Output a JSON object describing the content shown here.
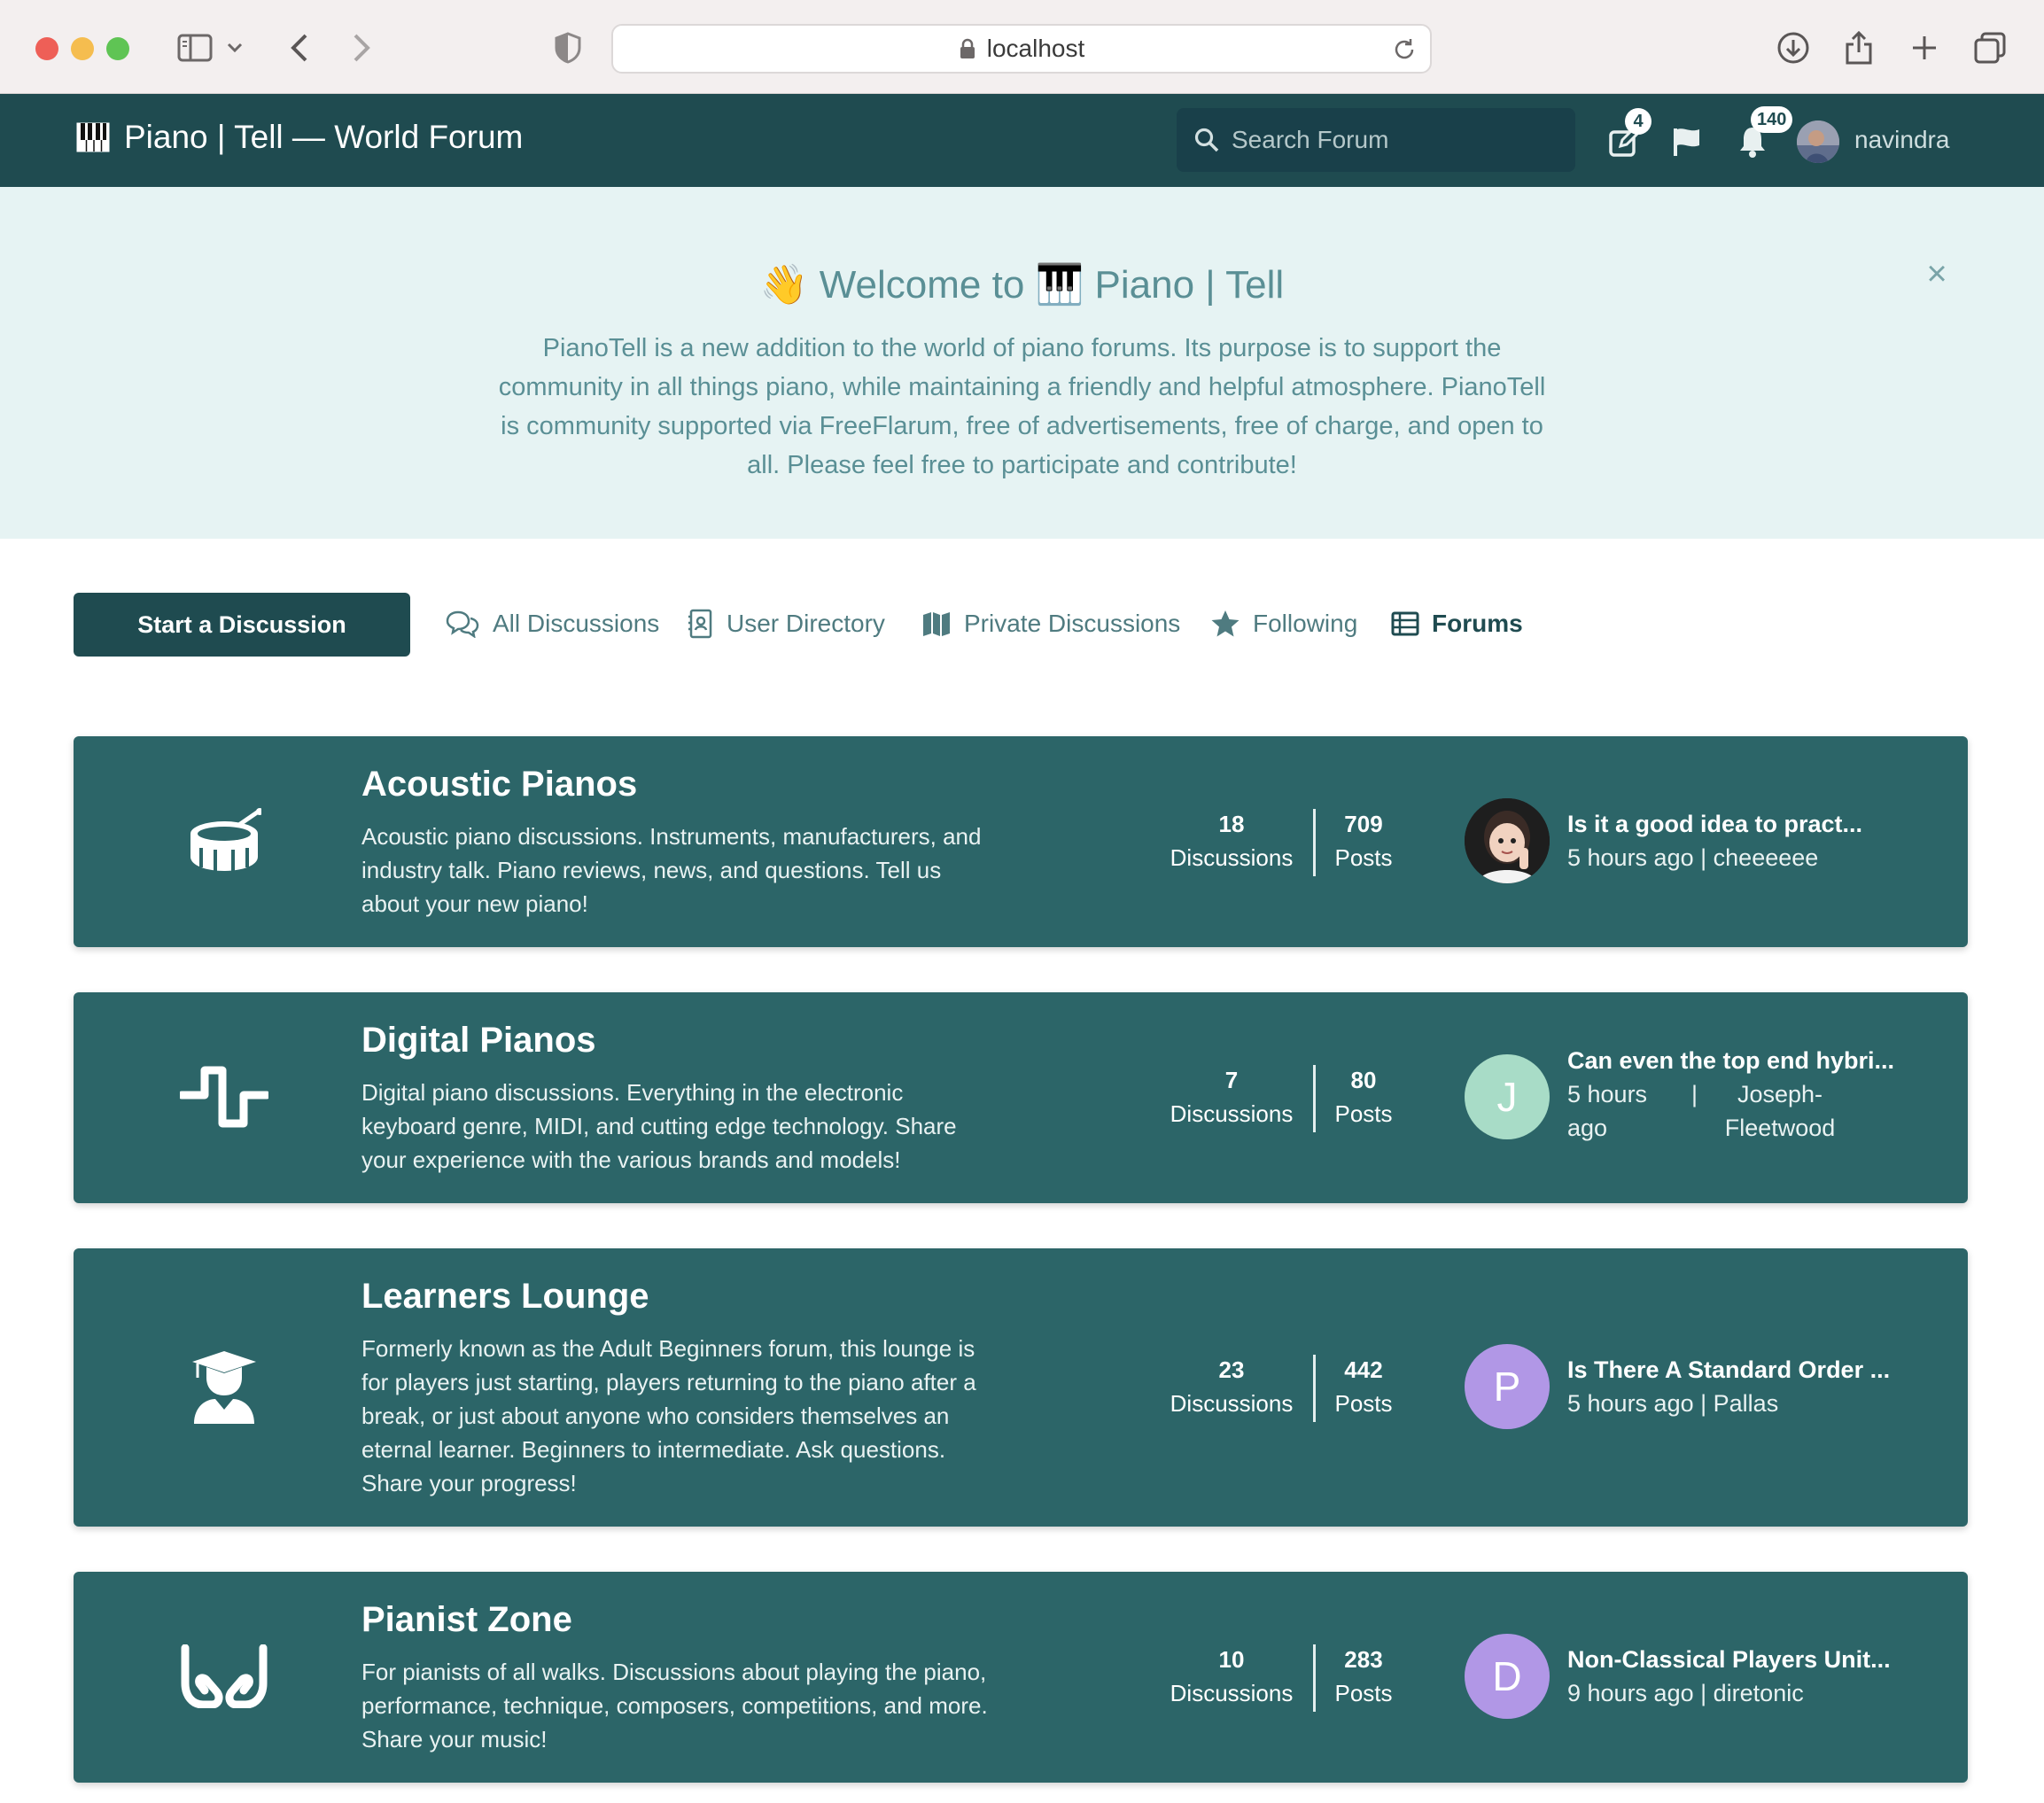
{
  "browser": {
    "url": "localhost"
  },
  "header": {
    "brand": "Piano | Tell — World Forum",
    "search_placeholder": "Search Forum",
    "compose_badge": "4",
    "notifications_badge": "140",
    "username": "navindra",
    "colors": {
      "bar": "#1f4b50",
      "search_bg": "#19404a"
    }
  },
  "hero": {
    "title": "👋 Welcome to 🎹 Piano | Tell",
    "text": "PianoTell is a new addition to the world of piano forums. Its purpose is to support the community in all things piano, while maintaining a friendly and helpful atmosphere. PianoTell is community supported via FreeFlarum, free of advertisements, free of charge, and open to all. Please feel free to participate and contribute!",
    "close_label": "×",
    "bg_color": "#e6f3f3"
  },
  "nav": {
    "start_label": "Start a Discussion",
    "items": [
      {
        "label": "All Discussions",
        "icon": "comments-icon"
      },
      {
        "label": "User Directory",
        "icon": "address-book-icon"
      },
      {
        "label": "Private Discussions",
        "icon": "map-icon"
      },
      {
        "label": "Following",
        "icon": "star-icon"
      },
      {
        "label": "Forums",
        "icon": "list-icon",
        "active": true
      }
    ]
  },
  "forums": [
    {
      "title": "Acoustic Pianos",
      "description": "Acoustic piano discussions. Instruments, manufacturers, and industry talk. Piano reviews, news, and questions. Tell us about your new piano!",
      "icon": "drum-icon",
      "discussions": "18",
      "discussions_label": "Discussions",
      "posts": "709",
      "posts_label": "Posts",
      "last": {
        "title": "Is it a good idea to pract...",
        "time": "5 hours ago",
        "sep": "|",
        "user": "cheeeeee",
        "avatar_letter": "",
        "avatar_color": "#2b2b2b"
      }
    },
    {
      "title": "Digital Pianos",
      "description": "Digital piano discussions. Everything in the electronic keyboard genre, MIDI, and cutting edge technology. Share your experience with the various brands and models!",
      "icon": "wave-square-icon",
      "discussions": "7",
      "discussions_label": "Discussions",
      "posts": "80",
      "posts_label": "Posts",
      "last": {
        "title": "Can even the top end hybri...",
        "time": "5 hours ago",
        "sep": "|",
        "user": "Joseph-Fleetwood",
        "avatar_letter": "J",
        "avatar_color": "#a8dcc7"
      }
    },
    {
      "title": "Learners Lounge",
      "description": "Formerly known as the Adult Beginners forum, this lounge is for players just starting, players returning to the piano after a break, or just about anyone who considers themselves an eternal learner. Beginners to intermediate. Ask questions. Share your progress!",
      "icon": "user-graduate-icon",
      "discussions": "23",
      "discussions_label": "Discussions",
      "posts": "442",
      "posts_label": "Posts",
      "last": {
        "title": "Is There A Standard Order ...",
        "time": "5 hours ago",
        "sep": "|",
        "user": "Pallas",
        "avatar_letter": "P",
        "avatar_color": "#b197e6"
      }
    },
    {
      "title": "Pianist Zone",
      "description": "For pianists of all walks. Discussions about playing the piano, performance, technique, composers, competitions, and more. Share your music!",
      "icon": "hands-icon",
      "discussions": "10",
      "discussions_label": "Discussions",
      "posts": "283",
      "posts_label": "Posts",
      "last": {
        "title": "Non-Classical Players Unit...",
        "time": "9 hours ago",
        "sep": "|",
        "user": "diretonic",
        "avatar_letter": "D",
        "avatar_color": "#b197e6"
      }
    }
  ],
  "colors": {
    "card": "#2c6568",
    "accent": "#1f4b50"
  }
}
